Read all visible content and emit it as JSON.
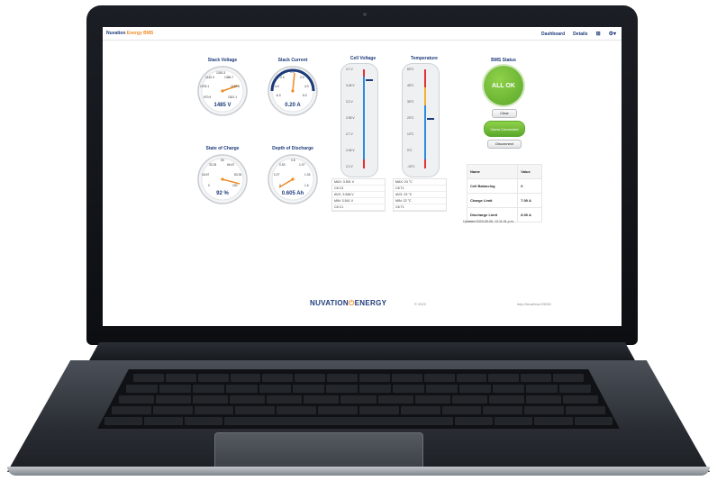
{
  "app": {
    "brand_primary": "Nuvation",
    "brand_accent": "Energy BMS",
    "nav": {
      "dashboard": "Dashboard",
      "details": "Details"
    },
    "icons": [
      "network-icon",
      "gear-icon"
    ]
  },
  "gauges": {
    "stack_voltage": {
      "title": "Stack Voltage",
      "ticks": [
        "1263.3",
        "1140.3",
        "1386.7",
        "1078.1",
        "1132.8",
        "970.9",
        "1521.1"
      ],
      "value": "1485 V"
    },
    "stack_current": {
      "title": "Stack Current",
      "ticks": [
        "0.0",
        "-2.0",
        "2.0",
        "-4.0",
        "4.0",
        "-6.0",
        "6.0"
      ],
      "value": "0.20 A"
    },
    "state_of_charge": {
      "title": "State of Charge",
      "ticks": [
        "50",
        "33.33",
        "66.67",
        "16.67",
        "83.33",
        "0",
        "100"
      ],
      "value": "92 %"
    },
    "depth_of_discharge": {
      "title": "Depth of Discharge",
      "ticks": [
        "0.8",
        "0.53",
        "1.07",
        "0.27",
        "1.33",
        "0",
        "1.6"
      ],
      "value": "0.605 Ah"
    }
  },
  "cell_voltage": {
    "title": "Cell Voltage",
    "ticks": [
      "3.7 V",
      "3.45 V",
      "3.2 V",
      "2.95 V",
      "2.7 V",
      "2.45 V",
      "2.2 V"
    ],
    "stats": [
      "MAX: 3.501 V",
      "C8 C3",
      "AVG: 3.548 V",
      "MIN: 3.541 V",
      "C8 C1"
    ]
  },
  "temperature": {
    "title": "Temperature",
    "ticks": [
      "60°C",
      "45°C",
      "30°C",
      "20°C",
      "10°C",
      "0°C",
      "-10°C"
    ],
    "stats": [
      "MAX: 24 °C",
      "C8 T1",
      "AVG: 23 °C",
      "MIN: 22 °C",
      "C8 T1"
    ]
  },
  "bms": {
    "title": "BMS Status",
    "status": "ALL OK",
    "clear_label": "Clear",
    "connected_label": "Users Connected",
    "disconnect_label": "Disconnect",
    "table_headers": [
      "Name",
      "Value"
    ],
    "table_rows": [
      {
        "name": "Cell Balancing",
        "value": "0"
      },
      {
        "name": "Charge Limit",
        "value": "7.00 A"
      },
      {
        "name": "Discharge Limit",
        "value": "8.00 A"
      }
    ],
    "updated": "Updated 2023-05-05, 12:11:31 p.m."
  },
  "footer": {
    "logo_left": "NUVATION",
    "logo_right": "ENERGY",
    "copyright": "© 2022",
    "url": "http://localhost:25001"
  },
  "colors": {
    "navy": "#1d3b7a",
    "orange": "#f08a24",
    "ok_green": "#6ab735"
  }
}
